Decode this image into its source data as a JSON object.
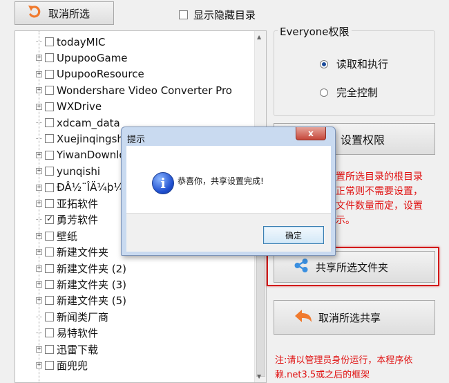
{
  "toolbar": {
    "cancel_selection_label": "取消所选",
    "show_hidden_label": "显示隐藏目录"
  },
  "tree": {
    "items": [
      {
        "label": "todayMIC",
        "checked": false,
        "expandable": false
      },
      {
        "label": "UpupooGame",
        "checked": false,
        "expandable": true
      },
      {
        "label": "UpupooResource",
        "checked": false,
        "expandable": true
      },
      {
        "label": "Wondershare Video Converter Pro",
        "checked": false,
        "expandable": true
      },
      {
        "label": "WXDrive",
        "checked": false,
        "expandable": true
      },
      {
        "label": "xdcam_data",
        "checked": false,
        "expandable": false
      },
      {
        "label": "Xuejinqingsh",
        "checked": false,
        "expandable": false
      },
      {
        "label": "YiwanDownlo",
        "checked": false,
        "expandable": true
      },
      {
        "label": "yunqishi",
        "checked": false,
        "expandable": true
      },
      {
        "label": "ÐÂ½¨ÎÄ¼þ¼",
        "checked": false,
        "expandable": true
      },
      {
        "label": "亚拓软件",
        "checked": false,
        "expandable": true
      },
      {
        "label": "勇芳软件",
        "checked": true,
        "expandable": false
      },
      {
        "label": "壁纸",
        "checked": false,
        "expandable": true
      },
      {
        "label": "新建文件夹",
        "checked": false,
        "expandable": true
      },
      {
        "label": "新建文件夹 (2)",
        "checked": false,
        "expandable": true
      },
      {
        "label": "新建文件夹 (3)",
        "checked": false,
        "expandable": true
      },
      {
        "label": "新建文件夹 (5)",
        "checked": false,
        "expandable": true
      },
      {
        "label": "新闻类厂商",
        "checked": false,
        "expandable": false
      },
      {
        "label": "易特软件",
        "checked": false,
        "expandable": false
      },
      {
        "label": "迅雷下载",
        "checked": false,
        "expandable": true
      },
      {
        "label": "面兜兜",
        "checked": false,
        "expandable": true
      }
    ]
  },
  "permissions": {
    "group_title": "Everyone权限",
    "option_read": "读取和执行",
    "option_full": "完全控制",
    "selected": "读取和执行",
    "set_button": "设置权限"
  },
  "note_partial": "置所选目录的根目录\n正常则不需要设置，\n文件数量而定，设置\n示。",
  "share_button": "共享所选文件夹",
  "cancel_share_button": "取消所选共享",
  "bottom_note": "注:请以管理员身份运行，本程序依赖.net3.5或之后的框架",
  "dialog": {
    "title": "提示",
    "message": "恭喜你，共享设置完成!",
    "ok_label": "确定",
    "close_label": "x"
  },
  "colors": {
    "warning_red": "#e01010",
    "highlight_red": "#d21a1a",
    "dialog_frame": "#c9daf0",
    "icon_orange": "#f07a2e",
    "icon_blue": "#3a8fe0"
  }
}
